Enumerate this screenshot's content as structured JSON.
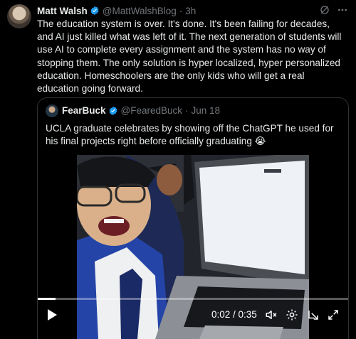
{
  "tweet": {
    "author_name": "Matt Walsh",
    "handle": "@MattWalshBlog",
    "time": "3h",
    "text": "The education system is over. It's done. It's been failing for decades, and AI just killed what was left of it. The next generation of students will use AI to complete every assignment and the system has no way of stopping them. The only solution is hyper localized, hyper personalized education. Homeschoolers are the only kids who will get a real education going forward."
  },
  "quote": {
    "author_name": "FearBuck",
    "handle": "@FearedBuck",
    "date": "Jun 18",
    "text": "UCLA graduate celebrates by showing off the ChatGPT he used for his final projects right before officially graduating 😭"
  },
  "video": {
    "current_time": "0:02",
    "duration": "0:35",
    "time_display": "0:02 / 0:35",
    "progress": 0.057
  },
  "colors": {
    "background": "#000000",
    "text": "#e7e9ea",
    "muted": "#71767b",
    "verified": "#1d9bf0",
    "border": "#2f3336"
  },
  "icons": [
    "verified-badge-icon",
    "grok-icon",
    "more-icon",
    "play-icon",
    "volume-muted-icon",
    "settings-icon",
    "pip-icon",
    "fullscreen-icon"
  ]
}
